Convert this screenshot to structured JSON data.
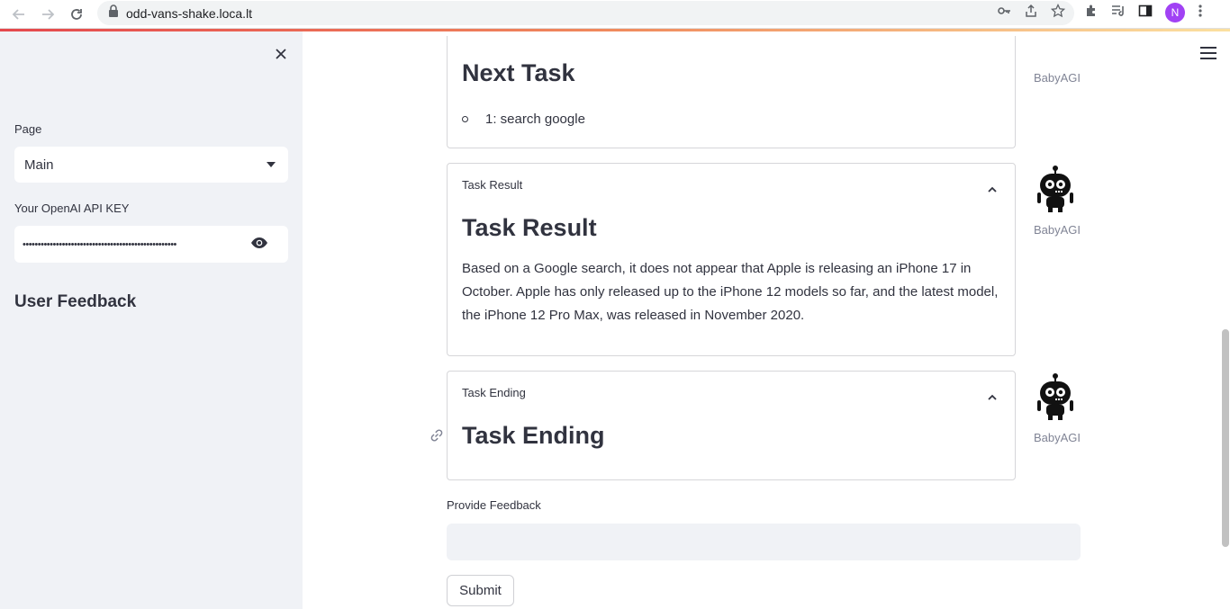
{
  "browser": {
    "url": "odd-vans-shake.loca.lt",
    "profile_initial": "N"
  },
  "sidebar": {
    "page_label": "Page",
    "page_selected": "Main",
    "api_key_label": "Your OpenAI API KEY",
    "api_key_value": "•••••••••••••••••••••••••••••••••••••••••••••••••••",
    "section_heading": "User Feedback"
  },
  "main": {
    "next_task": {
      "heading": "Next Task",
      "item": "1: search google",
      "author": "BabyAGI"
    },
    "task_result": {
      "header": "Task Result",
      "heading": "Task Result",
      "body": "Based on a Google search, it does not appear that Apple is releasing an iPhone 17 in October. Apple has only released up to the iPhone 12 models so far, and the latest model, the iPhone 12 Pro Max, was released in November 2020.",
      "author": "BabyAGI"
    },
    "task_ending": {
      "header": "Task Ending",
      "heading": "Task Ending",
      "author": "BabyAGI"
    },
    "feedback": {
      "label": "Provide Feedback",
      "value": "",
      "submit_label": "Submit"
    }
  }
}
